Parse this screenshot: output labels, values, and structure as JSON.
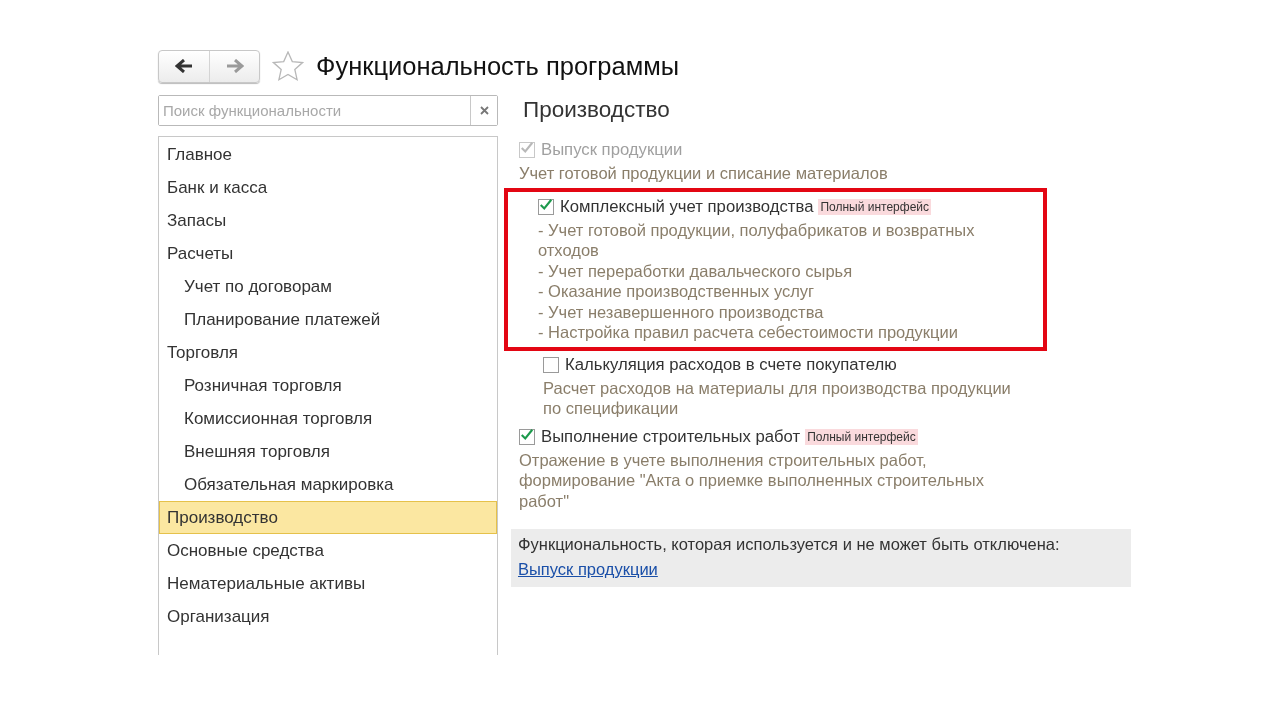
{
  "toolbar": {
    "back": {
      "disabled": false
    },
    "forward": {
      "disabled": true
    },
    "favorite": {
      "on": false
    },
    "title": "Функциональность программы"
  },
  "search": {
    "placeholder": "Поиск функциональности"
  },
  "sidebar": {
    "items": [
      {
        "label": "Главное",
        "selected": false
      },
      {
        "label": "Банк и касса",
        "selected": false
      },
      {
        "label": "Запасы",
        "selected": false
      },
      {
        "label": "Расчеты",
        "selected": false,
        "children": [
          {
            "label": "Учет по договорам",
            "selected": false
          },
          {
            "label": "Планирование платежей",
            "selected": false
          }
        ]
      },
      {
        "label": "Торговля",
        "selected": false,
        "children": [
          {
            "label": "Розничная торговля",
            "selected": false
          },
          {
            "label": "Комиссионная торговля",
            "selected": false
          },
          {
            "label": "Внешняя торговля",
            "selected": false
          },
          {
            "label": "Обязательная маркировка",
            "selected": false
          }
        ]
      },
      {
        "label": "Производство",
        "selected": true
      },
      {
        "label": "Основные средства",
        "selected": false
      },
      {
        "label": "Нематериальные активы",
        "selected": false
      },
      {
        "label": "Организация",
        "selected": false
      }
    ]
  },
  "section": {
    "title": "Производство",
    "options": [
      {
        "label": "Выпуск продукции",
        "checked": true,
        "disabled": true,
        "highlighted": false,
        "description": [
          "Учет готовой продукции и списание материалов"
        ],
        "children": [
          {
            "label": "Комплексный учет производства",
            "checked": true,
            "disabled": false,
            "highlighted": true,
            "badge": "Полный интерфейс",
            "description": [
              "- Учет готовой продукции, полуфабрикатов и возвратных отходов",
              "- Учет переработки давальческого сырья",
              "- Оказание производственных услуг",
              "- Учет незавершенного производства",
              "- Настройка правил расчета себестоимости продукции"
            ]
          },
          {
            "label": "Калькуляция расходов в счете покупателю",
            "checked": false,
            "disabled": false,
            "highlighted": false,
            "description": [
              "Расчет расходов на материалы для производства продукции по спецификации"
            ]
          }
        ]
      },
      {
        "label": "Выполнение строительных работ",
        "checked": true,
        "disabled": false,
        "highlighted": false,
        "badge": "Полный интерфейс",
        "description": [
          "Отражение в учете выполнения строительных работ, формирование \"Акта о приемке выполненных строительных работ\""
        ]
      }
    ],
    "info": {
      "text": "Функциональность, которая используется и не может быть отключена:",
      "link": "Выпуск продукции"
    }
  }
}
